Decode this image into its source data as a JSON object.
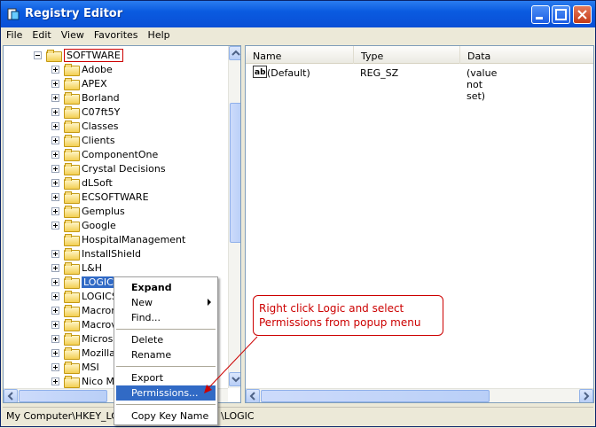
{
  "window": {
    "title": "Registry Editor",
    "min_icon": "minimize-icon",
    "max_icon": "maximize-icon",
    "close_icon": "close-icon",
    "title_color": "#0a4fd6"
  },
  "menu": [
    "File",
    "Edit",
    "View",
    "Favorites",
    "Help"
  ],
  "tree": {
    "root": "SOFTWARE",
    "items": [
      "Adobe",
      "APEX",
      "Borland",
      "C07ft5Y",
      "Classes",
      "Clients",
      "ComponentOne",
      "Crystal Decisions",
      "dLSoft",
      "ECSOFTWARE",
      "Gemplus",
      "Google",
      "HospitalManagement",
      "InstallShield",
      "L&H",
      "LOGIC",
      "LOGICS",
      "Macrom",
      "Macrov",
      "Microso",
      "MozillaF",
      "MSI",
      "Nico Ma"
    ],
    "selected": "LOGIC"
  },
  "list": {
    "columns": [
      "Name",
      "Type",
      "Data"
    ],
    "rows": [
      {
        "name": "(Default)",
        "type": "REG_SZ",
        "data": "(value not set)"
      }
    ]
  },
  "context_menu": [
    "Expand",
    "New",
    "Find...",
    "Delete",
    "Rename",
    "Export",
    "Permissions...",
    "Copy Key Name"
  ],
  "callout": {
    "line1": "Right click Logic and select",
    "line2": "Permissions from popup menu"
  },
  "status": {
    "left": "My Computer\\HKEY_LOCA",
    "right": "\\LOGIC"
  },
  "colors": {
    "selection": "#316ac5",
    "callout_red": "#cc0000"
  }
}
